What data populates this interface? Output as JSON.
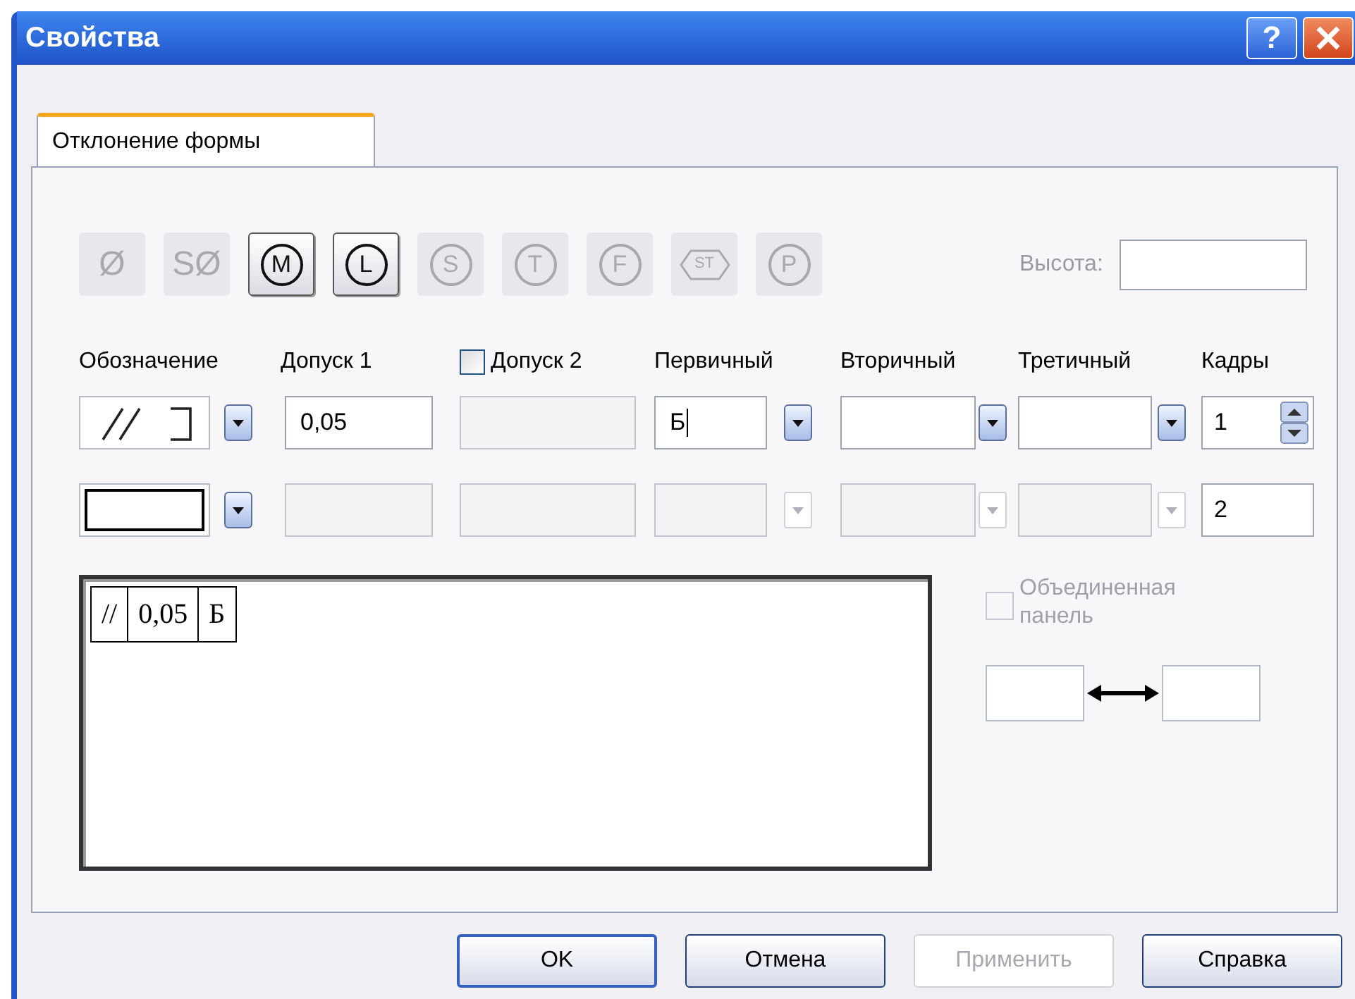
{
  "window": {
    "title": "Свойства",
    "help_label": "?"
  },
  "tabs": [
    {
      "label": "Отклонение формы",
      "selected": true
    }
  ],
  "symbol_buttons": [
    {
      "label": "Ø",
      "kind": "plain",
      "disabled": true
    },
    {
      "label": "SØ",
      "kind": "plain",
      "disabled": true
    },
    {
      "label": "M",
      "kind": "circle",
      "disabled": false
    },
    {
      "label": "L",
      "kind": "circle",
      "disabled": false
    },
    {
      "label": "S",
      "kind": "circle",
      "disabled": true
    },
    {
      "label": "T",
      "kind": "circle",
      "disabled": true
    },
    {
      "label": "F",
      "kind": "circle",
      "disabled": true
    },
    {
      "label": "ST",
      "kind": "hexagon",
      "disabled": true
    },
    {
      "label": "P",
      "kind": "circle",
      "disabled": true
    }
  ],
  "height_field": {
    "label": "Высота:",
    "disabled": true
  },
  "columns": [
    {
      "label": "Обозначение",
      "kind": "text"
    },
    {
      "label": "Допуск 1",
      "kind": "text"
    },
    {
      "label": "Допуск 2",
      "kind": "checkbox",
      "checked": false
    },
    {
      "label": "Первичный",
      "kind": "text"
    },
    {
      "label": "Вторичный",
      "kind": "text"
    },
    {
      "label": "Третичный",
      "kind": "text"
    },
    {
      "label": "Кадры",
      "kind": "text"
    }
  ],
  "rows": [
    {
      "kind": "parallelism",
      "tolerance_1": {
        "value": "0,05",
        "disabled": false
      },
      "tolerance_2": {
        "disabled": true
      },
      "primary": {
        "value": "Б",
        "disabled": false,
        "focused": true
      },
      "secondary": {
        "disabled": false
      },
      "tertiary": {
        "disabled": false
      },
      "frames": {
        "value": "1",
        "spinner": true
      }
    },
    {
      "kind": "empty",
      "tolerance_1": {
        "disabled": true
      },
      "tolerance_2": {
        "disabled": true
      },
      "primary": {
        "disabled": true,
        "focused": false
      },
      "secondary": {
        "disabled": true
      },
      "tertiary": {
        "disabled": true
      },
      "frames": {
        "value": "2",
        "spinner": false
      }
    }
  ],
  "preview": {
    "cells": [
      "//",
      "0,05",
      "Б"
    ]
  },
  "combined_panel": {
    "label": "Объединенная панель",
    "checked": false,
    "disabled": true
  },
  "buttons": [
    {
      "label": "OK",
      "disabled": false,
      "default": true
    },
    {
      "label": "Отмена",
      "disabled": false,
      "default": false
    },
    {
      "label": "Применить",
      "disabled": true,
      "default": false
    },
    {
      "label": "Справка",
      "disabled": false,
      "default": false
    }
  ]
}
